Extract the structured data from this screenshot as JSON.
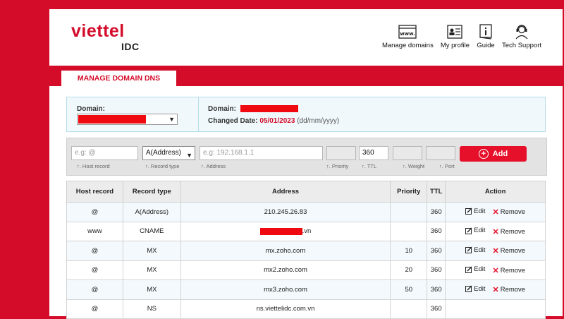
{
  "brand": {
    "logo_main": "viettel",
    "logo_sub": "IDC",
    "color": "#d40c2a"
  },
  "topnav": [
    {
      "label": "Manage domains",
      "icon": "www-browser-icon"
    },
    {
      "label": "My profile",
      "icon": "id-card-icon"
    },
    {
      "label": "Guide",
      "icon": "info-book-icon"
    },
    {
      "label": "Tech Support",
      "icon": "headset-user-icon"
    }
  ],
  "tab": {
    "label": "MANAGE DOMAIN DNS"
  },
  "domain_box": {
    "domain_label": "Domain:",
    "domain_label_right": "Domain:",
    "changed_label": "Changed Date:",
    "changed_value": "05/01/2023",
    "changed_hint": "(dd/mm/yyyy)"
  },
  "add_form": {
    "host_placeholder": "e.g: @",
    "record_type_value": "A(Address)",
    "address_placeholder": "e.g: 192.168.1.1",
    "ttl_value": "360",
    "hint_host": "Host record",
    "hint_type": "Record type",
    "hint_address": "Address",
    "hint_priority": "Priority",
    "hint_ttl": "TTL",
    "hint_weight": "Weight",
    "hint_port": "Port",
    "add_label": "Add"
  },
  "table": {
    "headers": [
      "Host record",
      "Record type",
      "Address",
      "Priority",
      "TTL",
      "Action"
    ],
    "edit_label": "Edit",
    "remove_label": "Remove",
    "rows": [
      {
        "host": "@",
        "type": "A(Address)",
        "address": "210.245.26.83",
        "priority": "",
        "ttl": "360",
        "actions": true
      },
      {
        "host": "www",
        "type": "CNAME",
        "address": ".vn",
        "priority": "",
        "ttl": "360",
        "actions": true
      },
      {
        "host": "@",
        "type": "MX",
        "address": "mx.zoho.com",
        "priority": "10",
        "ttl": "360",
        "actions": true
      },
      {
        "host": "@",
        "type": "MX",
        "address": "mx2.zoho.com",
        "priority": "20",
        "ttl": "360",
        "actions": true
      },
      {
        "host": "@",
        "type": "MX",
        "address": "mx3.zoho.com",
        "priority": "50",
        "ttl": "360",
        "actions": true
      },
      {
        "host": "@",
        "type": "NS",
        "address": "ns.viettelidc.com.vn",
        "priority": "",
        "ttl": "360",
        "actions": false
      }
    ]
  }
}
